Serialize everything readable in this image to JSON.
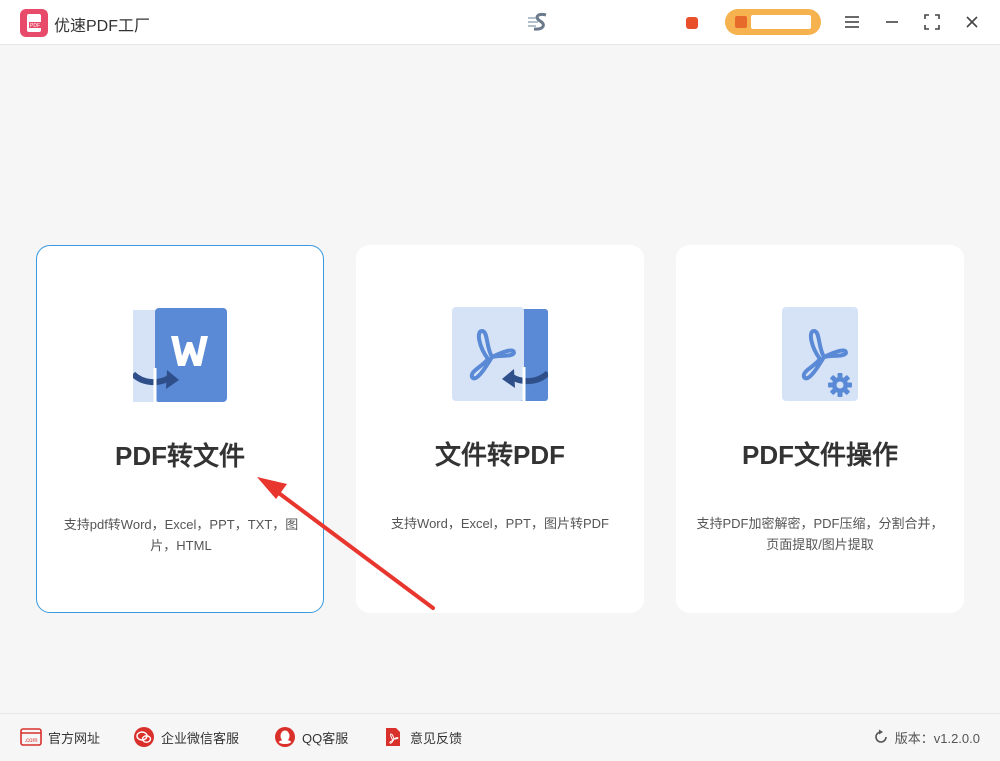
{
  "app": {
    "title": "优速PDF工厂",
    "logo_text": "PDF"
  },
  "header": {
    "user_name": "",
    "vip_label": ""
  },
  "cards": [
    {
      "title": "PDF转文件",
      "desc": "支持pdf转Word，Excel，PPT，TXT，图片，HTML",
      "icon": "pdf-to-word-icon"
    },
    {
      "title": "文件转PDF",
      "desc": "支持Word，Excel，PPT，图片转PDF",
      "icon": "file-to-pdf-icon"
    },
    {
      "title": "PDF文件操作",
      "desc": "支持PDF加密解密，PDF压缩，分割合并，页面提取/图片提取",
      "icon": "pdf-settings-icon"
    }
  ],
  "footer": {
    "website": "官方网址",
    "website_icon_text": ".com",
    "wechat": "企业微信客服",
    "qq": "QQ客服",
    "feedback": "意见反馈",
    "version": "版本：v1.2.0.0"
  },
  "colors": {
    "accent": "#3a9ae0",
    "brand": "#e84a6a",
    "vip": "#f5b24f",
    "icon_blue": "#5a8ad6",
    "icon_light": "#d6e3f7",
    "footer_red": "#d9302c"
  }
}
